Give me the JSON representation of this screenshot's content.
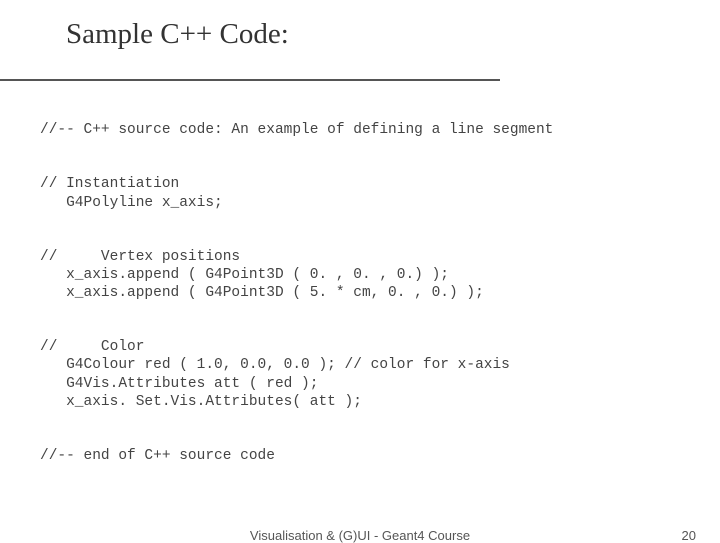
{
  "title": "Sample C++ Code:",
  "code": {
    "line1": "//-- C++ source code: An example of defining a line segment",
    "block2": "// Instantiation\n   G4Polyline x_axis;",
    "block3": "//     Vertex positions\n   x_axis.append ( G4Point3D ( 0. , 0. , 0.) );\n   x_axis.append ( G4Point3D ( 5. * cm, 0. , 0.) );",
    "block4": "//     Color\n   G4Colour red ( 1.0, 0.0, 0.0 ); // color for x-axis\n   G4Vis.Attributes att ( red );\n   x_axis. Set.Vis.Attributes( att );",
    "line5": "//-- end of C++ source code"
  },
  "footer": {
    "center": "Visualisation & (G)UI - Geant4 Course",
    "pageno": "20"
  }
}
